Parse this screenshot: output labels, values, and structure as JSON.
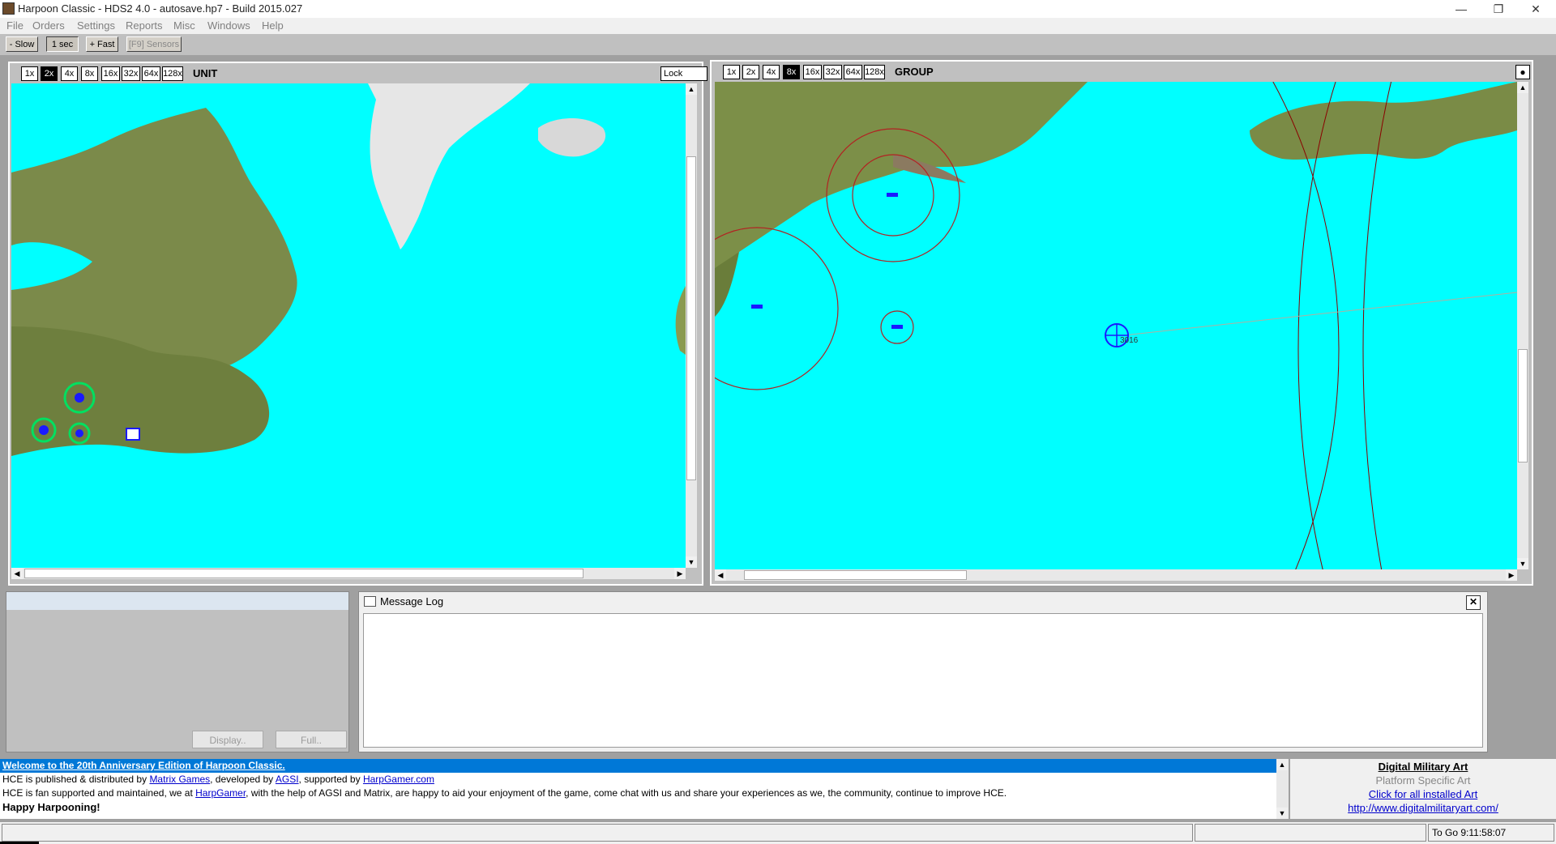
{
  "window": {
    "title": "Harpoon Classic - HDS2 4.0 - autosave.hp7 - Build 2015.027",
    "minimize": "—",
    "restore": "❐",
    "close": "✕"
  },
  "menu": [
    "File",
    "Orders",
    "Settings",
    "Reports",
    "Misc",
    "Windows",
    "Help"
  ],
  "toolbar": {
    "slow": "- Slow",
    "time": "1 sec",
    "fast": "+ Fast",
    "sensors": "[F9] Sensors"
  },
  "left_map": {
    "zoom_levels": [
      "1x",
      "2x",
      "4x",
      "8x",
      "16x",
      "32x",
      "64x",
      "128x"
    ],
    "active_zoom": "2x",
    "label": "UNIT",
    "lock_label": "Lock"
  },
  "right_map": {
    "zoom_levels": [
      "1x",
      "2x",
      "4x",
      "8x",
      "16x",
      "32x",
      "64x",
      "128x"
    ],
    "active_zoom": "8x",
    "label": "GROUP",
    "unit_label": "3016"
  },
  "unit_panel": {
    "display_button": "Display..",
    "full_button": "Full.."
  },
  "message_log": {
    "title": "Message Log",
    "close": "✕"
  },
  "news": {
    "headline": "Welcome to the 20th Anniversary Edition of Harpoon Classic.",
    "line2_prefix": "HCE is published & distributed by ",
    "line2_link1": "Matrix Games",
    "line2_mid1": ", developed by ",
    "line2_link2": "AGSI",
    "line2_mid2": ", supported by ",
    "line2_link3": "HarpGamer.com",
    "line3_prefix": "HCE is fan supported and maintained, we at ",
    "line3_link": "HarpGamer",
    "line3_suffix": ", with the help of AGSI and Matrix, are happy to aid your enjoyment of the game, come chat with us and share your experiences as we, the community, continue to improve HCE.",
    "line4": "Happy Harpooning!"
  },
  "art_panel": {
    "title": "Digital Military Art",
    "subtitle": "Platform Specific Art",
    "link1": "Click for all installed Art",
    "link2": "http://www.digitalmilitaryart.com/"
  },
  "status": {
    "to_go": "To Go 9:11:58:07"
  },
  "colors": {
    "sea": "#00ffff",
    "news_header": "#0078d7",
    "range_ring": "#b22222",
    "unit": "#1a1aff"
  }
}
